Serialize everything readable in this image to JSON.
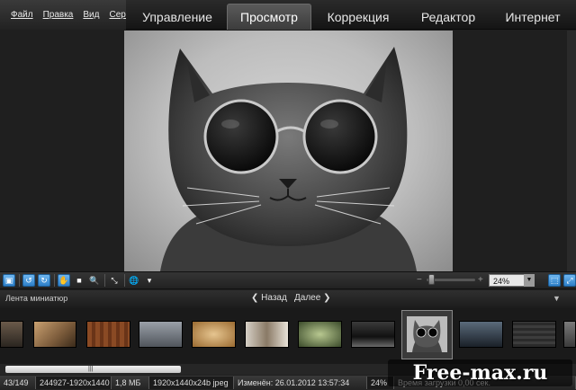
{
  "menu": {
    "items": [
      "Файл",
      "Правка",
      "Вид",
      "Серв"
    ]
  },
  "tabs": [
    {
      "label": "Управление",
      "active": false
    },
    {
      "label": "Просмотр",
      "active": true
    },
    {
      "label": "Коррекция",
      "active": false
    },
    {
      "label": "Редактор",
      "active": false
    },
    {
      "label": "Интернет",
      "active": false
    }
  ],
  "viewer": {
    "image_subject": "cat-with-round-sunglasses"
  },
  "viewbar": {
    "zoom_value": "24%",
    "zoom_min": "−",
    "zoom_max": "+",
    "zoom_slider_fraction": 0.1
  },
  "filmstrip": {
    "title": "Лента миниатюр",
    "back_label": "Назад",
    "forward_label": "Далее",
    "selected_index": 8
  },
  "status": {
    "position": "43/149",
    "file": "244927-1920x1440",
    "size": "1,8 МБ",
    "format": "1920x1440x24b jpeg",
    "modified": "Изменён: 26.01.2012 13:57:34",
    "zoom": "24%",
    "load_time": "Время загрузки 0,00 сек."
  },
  "watermark": "Free-max.ru",
  "colors": {
    "accent_blue": "#2d7fc7",
    "background": "#1f1f1f"
  }
}
